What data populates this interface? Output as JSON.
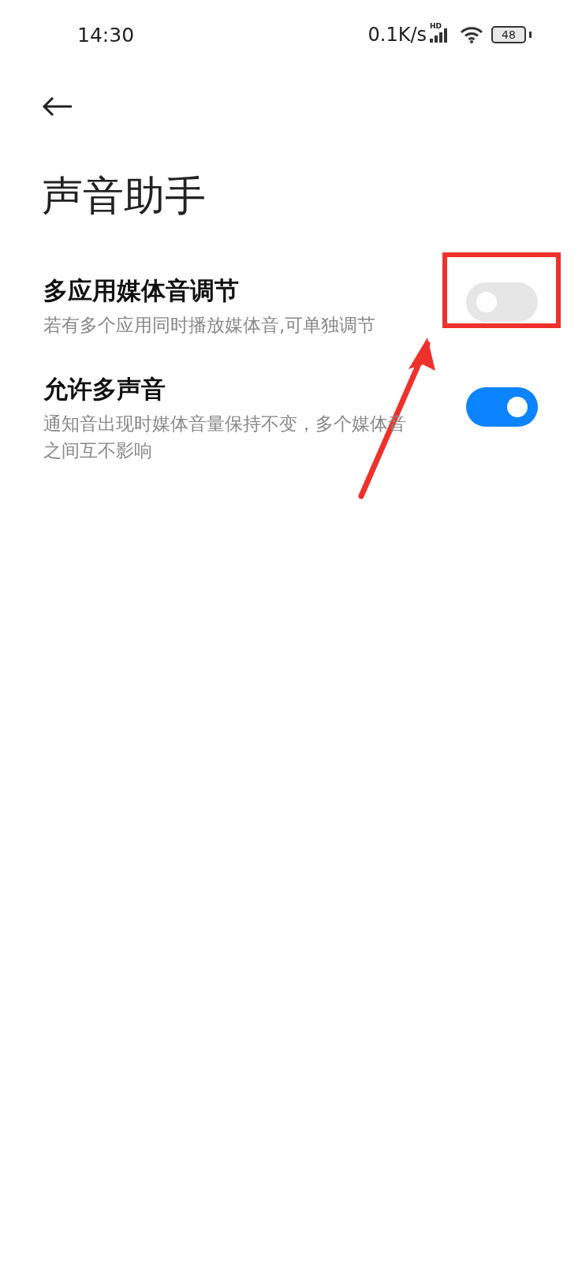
{
  "status_bar": {
    "time": "14:30",
    "speed": "0.1K/s",
    "network_badge": "HD",
    "battery": "48"
  },
  "title": "声音助手",
  "settings": [
    {
      "title": "多应用媒体音调节",
      "description": "若有多个应用同时播放媒体音,可单独调节",
      "on": false
    },
    {
      "title": "允许多声音",
      "description": "通知音出现时媒体音量保持不变，多个媒体音之间互不影响",
      "on": true
    }
  ]
}
